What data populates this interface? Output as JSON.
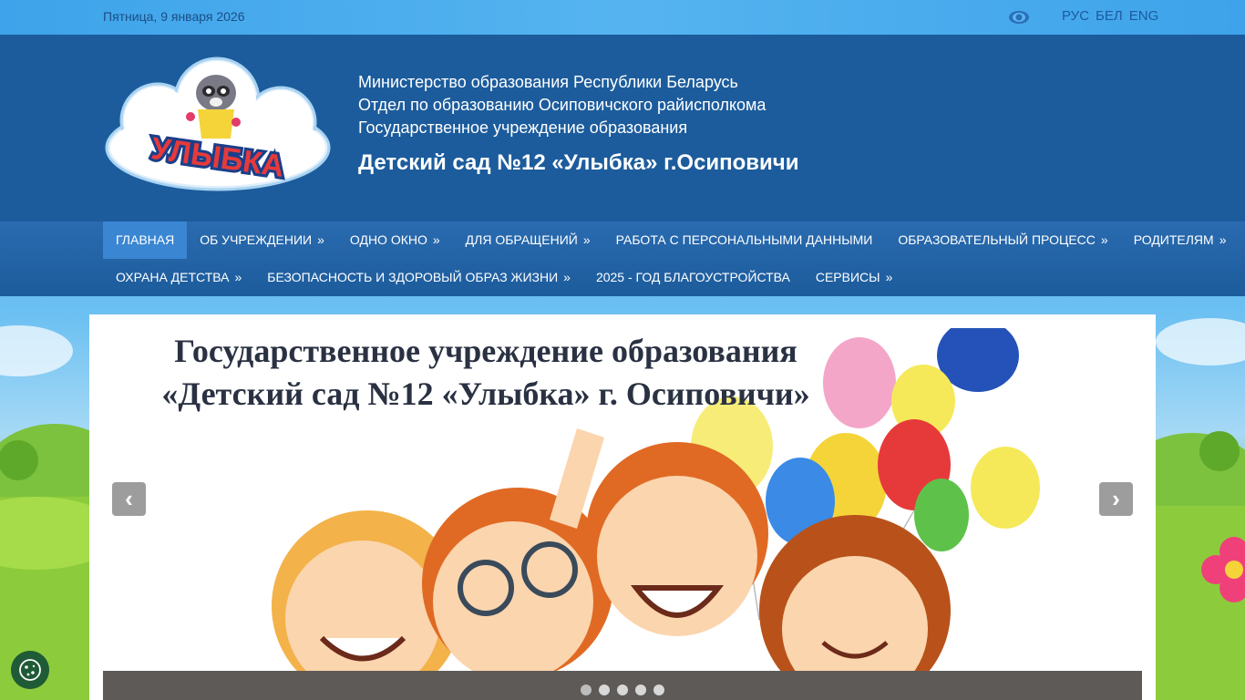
{
  "topbar": {
    "date": "Пятница, 9 января 2026",
    "languages": [
      "РУС",
      "БЕЛ",
      "ENG"
    ]
  },
  "header": {
    "lines": [
      "Министерство образования Республики Беларусь",
      "Отдел по образованию Осиповичского райисполкома",
      "Государственное учреждение образования"
    ],
    "title": "Детский сад №12 «Улыбка» г.Осиповичи",
    "logo_text": "УЛЫБКА"
  },
  "nav": {
    "row1": [
      {
        "label": "Главная",
        "arrow": ""
      },
      {
        "label": "Об учреждении",
        "arrow": "»"
      },
      {
        "label": "Одно окно",
        "arrow": "»"
      },
      {
        "label": "Для обращений",
        "arrow": "»"
      },
      {
        "label": "Работа с персональными данными",
        "arrow": ""
      },
      {
        "label": "Образовательный процесс",
        "arrow": "»"
      },
      {
        "label": "Родителям",
        "arrow": "»"
      }
    ],
    "row2": [
      {
        "label": "Охрана детства",
        "arrow": "»"
      },
      {
        "label": "Безопасность и здоровый образ жизни",
        "arrow": "»"
      },
      {
        "label": "2025 - год благоустройства",
        "arrow": ""
      },
      {
        "label": "Сервисы",
        "arrow": "»"
      }
    ]
  },
  "slider": {
    "title_line1": "Государственное учреждение образования",
    "title_line2": "«Детский сад №12 «Улыбка» г. Осиповичи»",
    "prev": "‹",
    "next": "›",
    "dot_count": 5,
    "active_dot": 0
  },
  "colors": {
    "header_bg": "#1c5c9c",
    "nav_active": "#3a86d2",
    "topbar": "#3ea3ea"
  }
}
